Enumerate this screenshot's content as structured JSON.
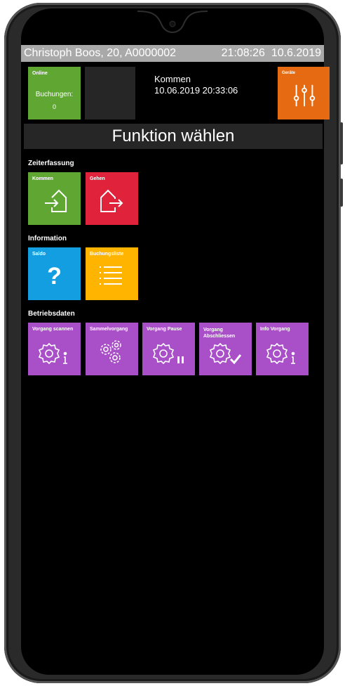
{
  "statusbar": {
    "user": "Christoph Boos, 20, A0000002",
    "time": "21:08:26",
    "date": "10.6.2019"
  },
  "top": {
    "online_title": "Online",
    "bookings_label": "Buchungen:",
    "bookings_count": "0",
    "last_action": "Kommen",
    "last_timestamp": "10.06.2019 20:33:06",
    "devices_title": "Geräte"
  },
  "header": {
    "title": "Funktion wählen"
  },
  "sections": {
    "time": {
      "title": "Zeiterfassung",
      "items": [
        {
          "label": "Kommen",
          "color": "#5fa732",
          "icon": "login-house-icon"
        },
        {
          "label": "Gehen",
          "color": "#e0233a",
          "icon": "logout-house-icon"
        }
      ]
    },
    "info": {
      "title": "Information",
      "items": [
        {
          "label": "Saldo",
          "color": "#129ee0",
          "icon": "question-icon"
        },
        {
          "label": "Buchungsliste",
          "color": "#ffb400",
          "icon": "list-icon"
        }
      ]
    },
    "ops": {
      "title": "Betriebsdaten",
      "items": [
        {
          "label": "Vorgang scannen",
          "color": "#a94fc7",
          "icon": "gear-info-icon"
        },
        {
          "label": "Sammelvorgang",
          "color": "#a94fc7",
          "icon": "multi-gear-icon"
        },
        {
          "label": "Vorgang Pause",
          "color": "#a94fc7",
          "icon": "gear-pause-icon"
        },
        {
          "label": "Vorgang Abschliessen",
          "color": "#a94fc7",
          "icon": "gear-check-icon"
        },
        {
          "label": "Info Vorgang",
          "color": "#a94fc7",
          "icon": "gear-info-icon"
        }
      ]
    }
  }
}
